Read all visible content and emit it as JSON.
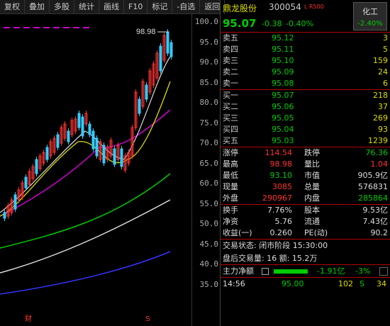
{
  "toolbar": [
    "复权",
    "叠加",
    "多股",
    "统计",
    "画线",
    "F10",
    "标记",
    "-自选",
    "返回"
  ],
  "axis": [
    "100.0",
    "95.0",
    "90.0",
    "85.0",
    "80.0",
    "75.0",
    "70.0",
    "65.0",
    "60.0",
    "55.0",
    "50.0",
    "45.0",
    "40.0",
    "35.0"
  ],
  "max_label": "98.98",
  "bottom_marks": {
    "cai": "财",
    "s": "S"
  },
  "stock": {
    "name": "鼎龙股份",
    "code": "300054",
    "tags": "L R500",
    "price": "95.07",
    "chg": "-0.38",
    "pct": "-0.40%",
    "sector": "化工",
    "sector_pct": "-2.40%"
  },
  "asks": [
    {
      "l": "卖五",
      "p": "95.12",
      "q": "3"
    },
    {
      "l": "卖四",
      "p": "95.11",
      "q": "5"
    },
    {
      "l": "卖三",
      "p": "95.10",
      "q": "159"
    },
    {
      "l": "卖二",
      "p": "95.09",
      "q": "24"
    },
    {
      "l": "卖一",
      "p": "95.08",
      "q": "6"
    }
  ],
  "bids": [
    {
      "l": "买一",
      "p": "95.07",
      "q": "218"
    },
    {
      "l": "买二",
      "p": "95.06",
      "q": "37"
    },
    {
      "l": "买三",
      "p": "95.05",
      "q": "269"
    },
    {
      "l": "买四",
      "p": "95.04",
      "q": "93"
    },
    {
      "l": "买五",
      "p": "95.03",
      "q": "1239"
    }
  ],
  "stats": [
    [
      "涨停",
      "114.54",
      "跌停",
      "76.36"
    ],
    [
      "最高",
      "98.98",
      "量比",
      "1.04"
    ],
    [
      "最低",
      "93.10",
      "市值",
      "905.9亿"
    ],
    [
      "现量",
      "3085",
      "总量",
      "576831"
    ],
    [
      "外盘",
      "290967",
      "内盘",
      "285864"
    ]
  ],
  "stats2": [
    [
      "换手",
      "7.76%",
      "股本",
      "9.53亿"
    ],
    [
      "净资",
      "5.76",
      "流通",
      "7.43亿"
    ],
    [
      "收益(一)",
      "0.260",
      "PE(动)",
      "90.2"
    ]
  ],
  "trade": {
    "status": "交易状态: 闭市阶段 15:30:00",
    "after": "盘后交易量: 16  额: 15.2万"
  },
  "flow": {
    "label": "主力净额",
    "v1": "-1.91亿",
    "v2": "-3%"
  },
  "tick": {
    "time": "14:56",
    "price": "95.00",
    "vol": "102",
    "dir": "S",
    "n": "34"
  }
}
